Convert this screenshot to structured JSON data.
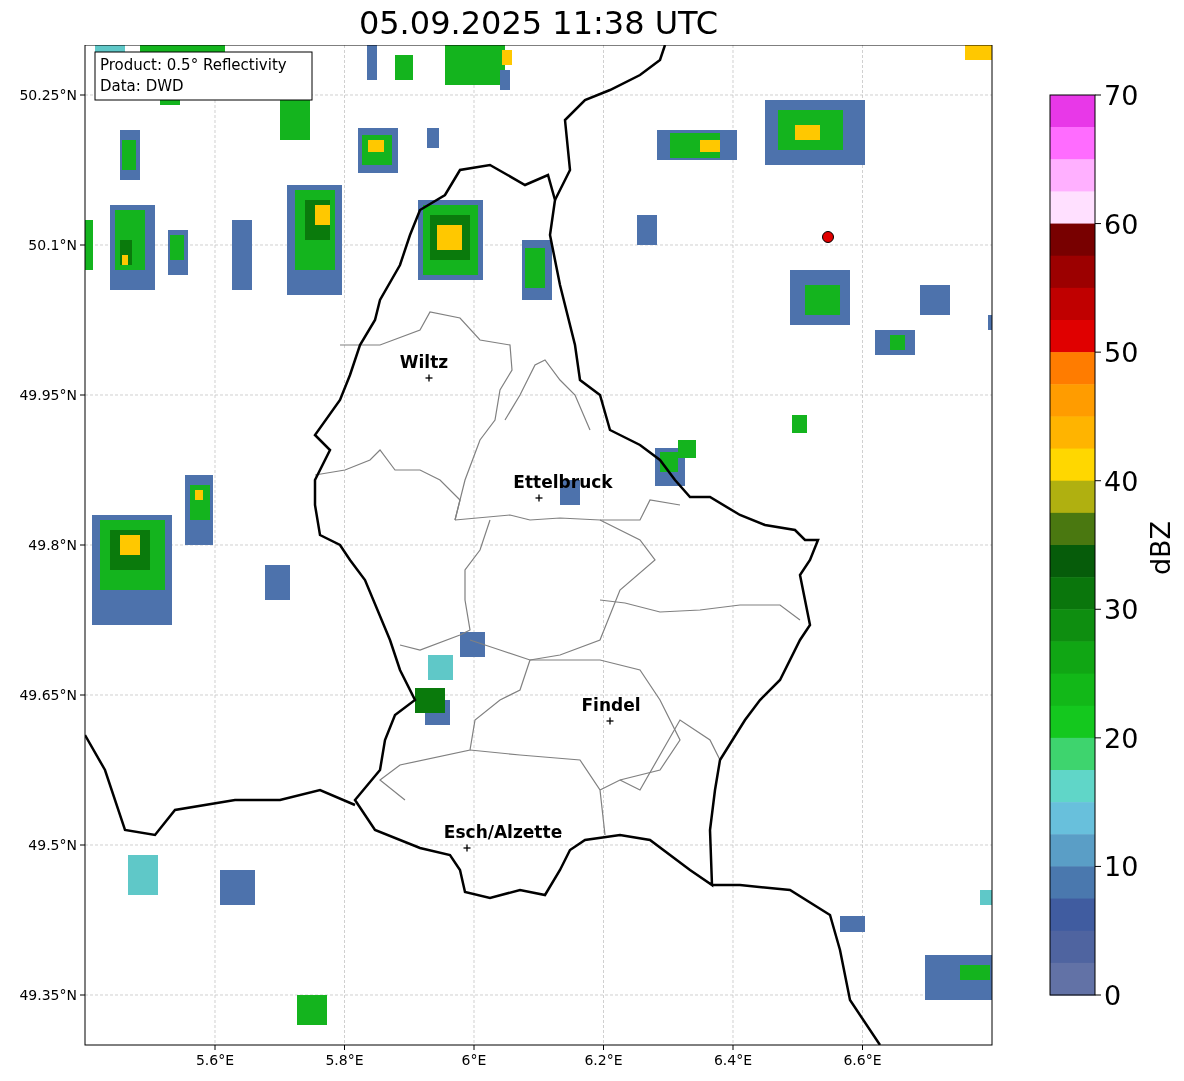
{
  "title": "05.09.2025 11:38 UTC",
  "info_box": {
    "lines": [
      "Product: 0.5° Reflectivity",
      "Data: DWD"
    ]
  },
  "map": {
    "xticks": [
      "5.6°E",
      "5.8°E",
      "6°E",
      "6.2°E",
      "6.4°E",
      "6.6°E"
    ],
    "yticks": [
      "50.25°N",
      "50.1°N",
      "49.95°N",
      "49.8°N",
      "49.65°N",
      "49.5°N",
      "49.35°N"
    ],
    "cities": [
      {
        "name": "Wiltz"
      },
      {
        "name": "Ettelbruck"
      },
      {
        "name": "Findel"
      },
      {
        "name": "Esch/Alzette"
      }
    ]
  },
  "colorbar": {
    "label": "dBZ",
    "ticks": [
      "70",
      "60",
      "50",
      "40",
      "30",
      "20",
      "10",
      "0"
    ],
    "segments": [
      {
        "color": "#e838e8"
      },
      {
        "color": "#ff6cff"
      },
      {
        "color": "#ffb0ff"
      },
      {
        "color": "#ffe0ff"
      },
      {
        "color": "#780000"
      },
      {
        "color": "#9c0000"
      },
      {
        "color": "#c00000"
      },
      {
        "color": "#e00000"
      },
      {
        "color": "#ff7c00"
      },
      {
        "color": "#ff9c00"
      },
      {
        "color": "#ffb400"
      },
      {
        "color": "#ffd700"
      },
      {
        "color": "#b0b010"
      },
      {
        "color": "#4a7810"
      },
      {
        "color": "#065c0a"
      },
      {
        "color": "#0a760c"
      },
      {
        "color": "#0e8e10"
      },
      {
        "color": "#10a614"
      },
      {
        "color": "#12b818"
      },
      {
        "color": "#14c81e"
      },
      {
        "color": "#3ed46e"
      },
      {
        "color": "#60d6c8"
      },
      {
        "color": "#68c0dc"
      },
      {
        "color": "#5a9ec6"
      },
      {
        "color": "#4a78ae"
      },
      {
        "color": "#405ca0"
      },
      {
        "color": "#4f64a0"
      },
      {
        "color": "#6272a6"
      }
    ]
  }
}
